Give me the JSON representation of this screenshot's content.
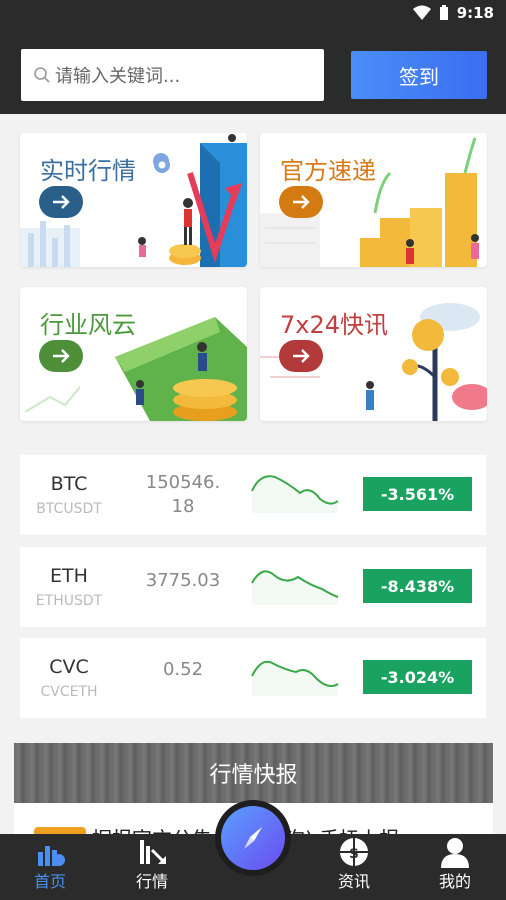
{
  "status": {
    "time": "9:18"
  },
  "search": {
    "placeholder": "请输入关键词..."
  },
  "checkin_label": "签到",
  "cards": [
    {
      "title": "实时行情",
      "color": "#3a6fa0"
    },
    {
      "title": "官方速递",
      "color": "#d87a1a"
    },
    {
      "title": "行业风云",
      "color": "#4a9a3a"
    },
    {
      "title": "7x24快讯",
      "color": "#c04040"
    }
  ],
  "tickers": [
    {
      "symbol": "BTC",
      "pair": "BTCUSDT",
      "price_line1": "150546.",
      "price_line2": "18",
      "change": "-3.561%"
    },
    {
      "symbol": "ETH",
      "pair": "ETHUSDT",
      "price_line1": "3775.03",
      "price_line2": "",
      "change": "-8.438%"
    },
    {
      "symbol": "CVC",
      "pair": "CVCETH",
      "price_line1": "0.52",
      "price_line2": "",
      "change": "-3.024%"
    }
  ],
  "banner_title": "行情快报",
  "news_preview": "据报官方公告... (门头沟) 手抚上报",
  "tabs": [
    {
      "label": "首页",
      "icon": "home-coins-icon"
    },
    {
      "label": "行情",
      "icon": "chart-icon"
    },
    {
      "label": "资讯",
      "icon": "globe-dollar-icon"
    },
    {
      "label": "我的",
      "icon": "user-icon"
    }
  ],
  "colors": {
    "accent": "#4a90f0",
    "down": "#1aa360",
    "dark": "#2b2b2b"
  }
}
